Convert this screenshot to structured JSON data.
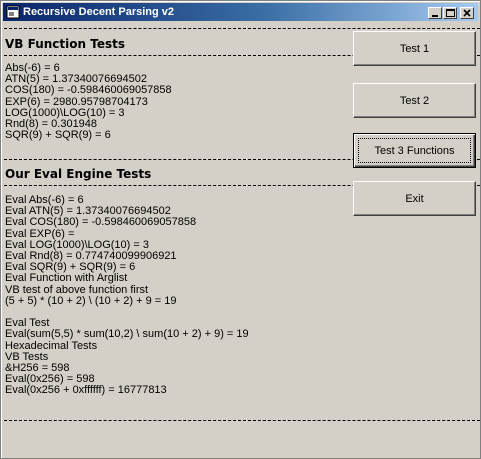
{
  "window": {
    "title": "Recursive Decent Parsing v2"
  },
  "output": {
    "vb_header": "VB Function Tests",
    "vb_lines": [
      "Abs(-6) = 6",
      "ATN(5) = 1.37340076694502",
      "COS(180) = -0.598460069057858",
      "EXP(6) = 2980.95798704173",
      "LOG(1000)\\LOG(10) = 3",
      "Rnd(8) = 0.301948",
      "SQR(9) + SQR(9) = 6"
    ],
    "eval_header": "Our Eval Engine Tests",
    "eval_lines": [
      "Eval Abs(-6) = 6",
      "Eval ATN(5) = 1.37340076694502",
      "Eval COS(180) = -0.598460069057858",
      "Eval EXP(6) =",
      "Eval LOG(1000)\\LOG(10) = 3",
      "Eval Rnd(8) = 0.774740099906921",
      "Eval SQR(9) + SQR(9) = 6",
      "Eval Function with Arglist",
      "VB test of above function first",
      "(5 + 5) * (10 + 2) \\ (10 + 2) + 9 = 19",
      "",
      "Eval Test",
      "Eval(sum(5,5) * sum(10,2) \\ sum(10 + 2) + 9) = 19",
      "Hexadecimal Tests",
      "VB Tests",
      "&H256 = 598",
      "Eval(0x256) = 598",
      "Eval(0x256 + 0xffffff) = 16777813"
    ]
  },
  "buttons": {
    "test1": "Test 1",
    "test2": "Test 2",
    "test3": "Test 3 Functions",
    "exit": "Exit"
  }
}
